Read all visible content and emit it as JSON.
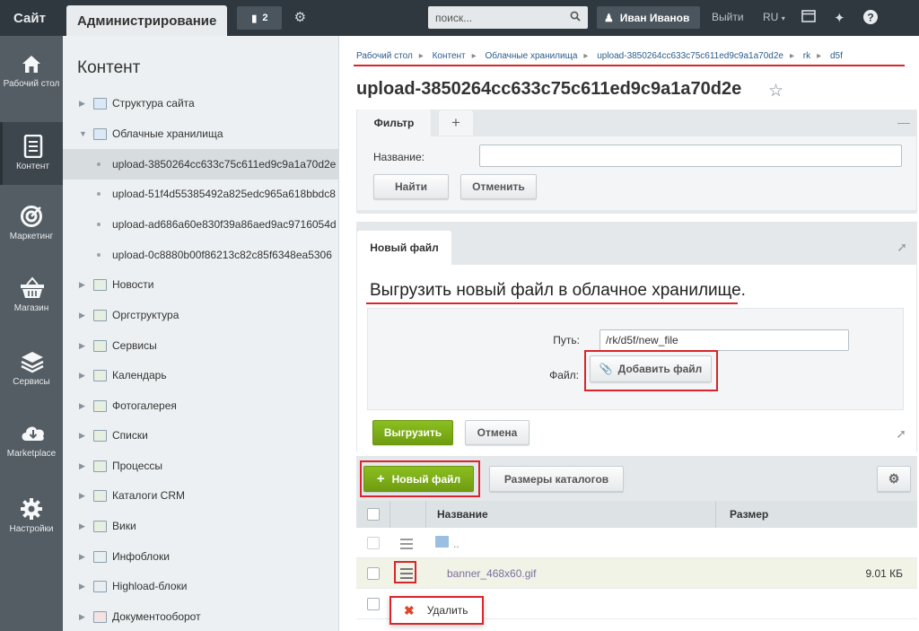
{
  "topbar": {
    "site_label": "Сайт",
    "admin_label": "Администрирование",
    "notifications_count": "2",
    "search_placeholder": "поиск...",
    "user_name": "Иван Иванов",
    "logout_label": "Выйти",
    "language": "RU"
  },
  "sidebar": {
    "items": [
      {
        "label": "Рабочий стол",
        "icon": "home-icon"
      },
      {
        "label": "Контент",
        "icon": "document-icon"
      },
      {
        "label": "Маркетинг",
        "icon": "target-icon"
      },
      {
        "label": "Магазин",
        "icon": "basket-icon"
      },
      {
        "label": "Сервисы",
        "icon": "layers-icon"
      },
      {
        "label": "Marketplace",
        "icon": "cloud-download-icon"
      },
      {
        "label": "Настройки",
        "icon": "gear-icon"
      }
    ]
  },
  "tree": {
    "title": "Контент",
    "nodes": [
      {
        "label": "Структура сайта"
      },
      {
        "label": "Облачные хранилища"
      },
      {
        "label": "upload-3850264cc633c75c611ed9c9a1a70d2e"
      },
      {
        "label": "upload-51f4d55385492a825edc965a618bbdc8"
      },
      {
        "label": "upload-ad686a60e830f39a86aed9ac9716054d"
      },
      {
        "label": "upload-0c8880b00f86213c82c85f6348ea5306"
      },
      {
        "label": "Новости"
      },
      {
        "label": "Оргструктура"
      },
      {
        "label": "Сервисы"
      },
      {
        "label": "Календарь"
      },
      {
        "label": "Фотогалерея"
      },
      {
        "label": "Списки"
      },
      {
        "label": "Процессы"
      },
      {
        "label": "Каталоги CRM"
      },
      {
        "label": "Вики"
      },
      {
        "label": "Инфоблоки"
      },
      {
        "label": "Highload-блоки"
      },
      {
        "label": "Документооборот"
      }
    ]
  },
  "breadcrumbs": [
    "Рабочий стол",
    "Контент",
    "Облачные хранилища",
    "upload-3850264cc633c75c611ed9c9a1a70d2e",
    "rk",
    "d5f"
  ],
  "page_title": "upload-3850264cc633c75c611ed9c9a1a70d2e",
  "filter": {
    "tab_label": "Фильтр",
    "add_tab": "+",
    "name_label": "Название:",
    "find_button": "Найти",
    "cancel_button": "Отменить"
  },
  "new_file": {
    "tab_label": "Новый файл",
    "heading": "Выгрузить новый файл в облачное хранилище.",
    "path_label": "Путь:",
    "path_value": "/rk/d5f/new_file",
    "file_label": "Файл:",
    "add_file_button": "Добавить файл",
    "upload_button": "Выгрузить",
    "cancel_button": "Отмена"
  },
  "toolbar": {
    "new_file_button": "Новый файл",
    "dir_sizes_button": "Размеры каталогов"
  },
  "grid": {
    "headers": {
      "name": "Название",
      "size": "Размер"
    },
    "rows": [
      {
        "name": "..",
        "size": ""
      },
      {
        "name": "banner_468x60.gif",
        "size": "9.01 КБ"
      }
    ]
  },
  "context_menu": {
    "delete_label": "Удалить"
  },
  "colors": {
    "topbar_bg": "#2f383f",
    "sidebar_bg": "#545d64",
    "accent_green": "#7aab17",
    "highlight_red": "#d9252b",
    "link_color": "#2b5d8b"
  }
}
